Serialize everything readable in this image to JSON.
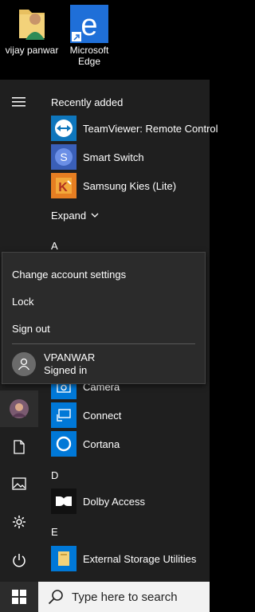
{
  "desktop": {
    "icons": [
      {
        "label": "vijay panwar",
        "icon": "user-folder-icon"
      },
      {
        "label": "Microsoft Edge",
        "icon": "edge-icon"
      }
    ]
  },
  "start_menu": {
    "recently_added_label": "Recently added",
    "recent_apps": [
      {
        "name": "TeamViewer: Remote Control",
        "icon": "teamviewer-icon",
        "color": "#0e76bc"
      },
      {
        "name": "Smart Switch",
        "icon": "smart-switch-icon",
        "color": "#4b7bd8"
      },
      {
        "name": "Samsung Kies (Lite)",
        "icon": "samsung-kies-icon",
        "color": "#f0a020"
      }
    ],
    "expand_label": "Expand",
    "section_a": "A",
    "section_c_apps": [
      {
        "name": "Camera",
        "icon": "camera-icon",
        "color": "#0078d7"
      },
      {
        "name": "Connect",
        "icon": "connect-icon",
        "color": "#0078d7"
      },
      {
        "name": "Cortana",
        "icon": "cortana-icon",
        "color": "#0078d7"
      }
    ],
    "section_d": "D",
    "section_d_apps": [
      {
        "name": "Dolby Access",
        "icon": "dolby-icon",
        "color": "#111111"
      }
    ],
    "section_e": "E",
    "section_e_apps": [
      {
        "name": "External Storage Utilities",
        "icon": "external-storage-icon",
        "color": "#0078d7"
      }
    ]
  },
  "account_flyout": {
    "items": [
      "Change account settings",
      "Lock",
      "Sign out"
    ],
    "user_name": "VPANWAR",
    "user_status": "Signed in"
  },
  "taskbar": {
    "search_placeholder": "Type here to search"
  },
  "colors": {
    "accent": "#0078d7",
    "menu_bg": "#1f1f1f",
    "flyout_bg": "#2b2b2b"
  }
}
